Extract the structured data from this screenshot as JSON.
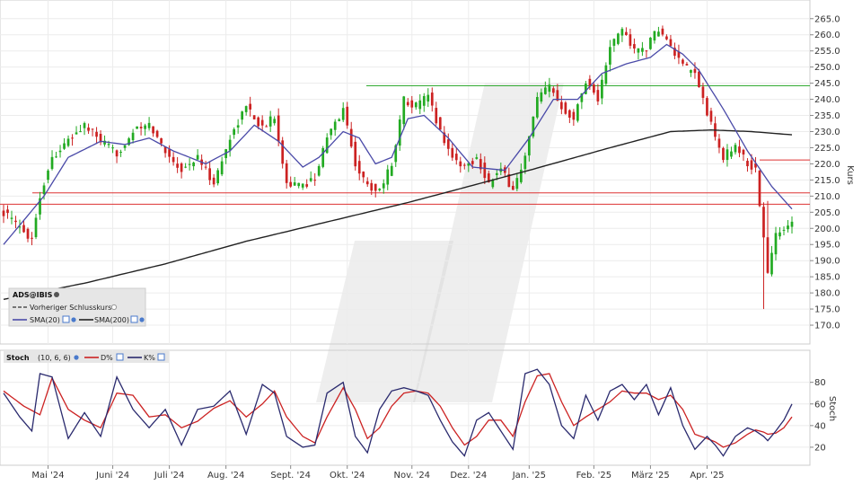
{
  "chart_data": [
    {
      "type": "candlestick",
      "ylabel": "Kurs",
      "ylim": [
        165,
        268
      ],
      "y_ticks": [
        170,
        175,
        180,
        185,
        190,
        195,
        200,
        205,
        210,
        215,
        220,
        225,
        230,
        235,
        240,
        245,
        250,
        255,
        260,
        265
      ],
      "x_labels": [
        "Mai '24",
        "Juni '24",
        "Juli '24",
        "Aug. '24",
        "Sept. '24",
        "Okt. '24",
        "Nov. '24",
        "Dez. '24",
        "Jan. '25",
        "Feb. '25",
        "März '25",
        "Apr. '25"
      ],
      "grid": true,
      "colors": {
        "up": "#22aa22",
        "down": "#cc2222",
        "sma20": "#4a4aa8",
        "sma200": "#222222",
        "support": "#dd3333",
        "resistance": "#33aa33"
      },
      "anchors": [
        [
          0,
          205
        ],
        [
          4,
          200
        ],
        [
          7,
          197
        ],
        [
          9,
          210
        ],
        [
          12,
          222
        ],
        [
          16,
          227
        ],
        [
          20,
          232
        ],
        [
          24,
          227
        ],
        [
          28,
          223
        ],
        [
          32,
          230
        ],
        [
          36,
          232
        ],
        [
          40,
          224
        ],
        [
          44,
          218
        ],
        [
          48,
          222
        ],
        [
          52,
          214
        ],
        [
          56,
          228
        ],
        [
          60,
          238
        ],
        [
          64,
          231
        ],
        [
          67,
          235
        ],
        [
          70,
          214
        ],
        [
          74,
          213
        ],
        [
          77,
          216
        ],
        [
          80,
          228
        ],
        [
          84,
          237
        ],
        [
          87,
          220
        ],
        [
          90,
          213
        ],
        [
          93,
          212
        ],
        [
          96,
          220
        ],
        [
          99,
          240
        ],
        [
          102,
          238
        ],
        [
          105,
          241
        ],
        [
          108,
          230
        ],
        [
          111,
          222
        ],
        [
          114,
          219
        ],
        [
          117,
          222
        ],
        [
          120,
          214
        ],
        [
          123,
          218
        ],
        [
          126,
          212
        ],
        [
          129,
          222
        ],
        [
          132,
          240
        ],
        [
          135,
          244
        ],
        [
          138,
          238
        ],
        [
          141,
          234
        ],
        [
          144,
          246
        ],
        [
          147,
          240
        ],
        [
          150,
          256
        ],
        [
          153,
          262
        ],
        [
          156,
          255
        ],
        [
          159,
          256
        ],
        [
          162,
          262
        ],
        [
          165,
          256
        ],
        [
          168,
          250
        ],
        [
          171,
          248
        ],
        [
          174,
          236
        ],
        [
          176,
          228
        ],
        [
          178,
          222
        ],
        [
          181,
          226
        ],
        [
          184,
          220
        ],
        [
          186,
          218
        ],
        [
          188,
          197
        ],
        [
          189,
          186
        ],
        [
          191,
          198
        ],
        [
          193,
          200
        ],
        [
          195,
          203
        ]
      ],
      "sma20_anchors": [
        [
          0,
          195
        ],
        [
          10,
          210
        ],
        [
          16,
          222
        ],
        [
          24,
          227
        ],
        [
          30,
          226
        ],
        [
          36,
          228
        ],
        [
          42,
          224
        ],
        [
          50,
          220
        ],
        [
          56,
          224
        ],
        [
          62,
          232
        ],
        [
          68,
          227
        ],
        [
          74,
          219
        ],
        [
          78,
          222
        ],
        [
          84,
          230
        ],
        [
          88,
          228
        ],
        [
          92,
          220
        ],
        [
          96,
          222
        ],
        [
          100,
          234
        ],
        [
          104,
          235
        ],
        [
          110,
          228
        ],
        [
          116,
          219
        ],
        [
          124,
          218
        ],
        [
          130,
          228
        ],
        [
          136,
          240
        ],
        [
          142,
          240
        ],
        [
          148,
          248
        ],
        [
          154,
          251
        ],
        [
          160,
          253
        ],
        [
          164,
          257
        ],
        [
          168,
          254
        ],
        [
          172,
          249
        ],
        [
          178,
          237
        ],
        [
          184,
          224
        ],
        [
          190,
          213
        ],
        [
          195,
          206
        ]
      ],
      "sma200_anchors": [
        [
          0,
          178
        ],
        [
          20,
          183
        ],
        [
          40,
          189
        ],
        [
          60,
          196
        ],
        [
          80,
          202
        ],
        [
          100,
          208
        ],
        [
          115,
          213
        ],
        [
          130,
          218
        ],
        [
          150,
          225
        ],
        [
          165,
          230
        ],
        [
          175,
          230.5
        ],
        [
          185,
          230
        ],
        [
          195,
          229
        ]
      ],
      "levels_red": [
        221.2,
        211,
        207.5
      ],
      "level_green": 244.2,
      "legend": {
        "symbol": "ADS@IBIS",
        "previous_close": "Vorheriger Schlusskurs",
        "sma20": "SMA(20)",
        "sma200": "SMA(200)"
      }
    },
    {
      "type": "line",
      "title": "Stoch",
      "params": "(10, 6, 6)",
      "ylabel": "Stoch",
      "ylim": [
        5,
        98
      ],
      "y_ticks": [
        20,
        40,
        60,
        80
      ],
      "series": [
        {
          "name": "D%",
          "color": "#cc2222"
        },
        {
          "name": "K%",
          "color": "#2a2a6e"
        }
      ],
      "k_anchors": [
        [
          0,
          70
        ],
        [
          4,
          48
        ],
        [
          7,
          35
        ],
        [
          9,
          88
        ],
        [
          12,
          85
        ],
        [
          16,
          28
        ],
        [
          20,
          52
        ],
        [
          24,
          30
        ],
        [
          28,
          85
        ],
        [
          32,
          55
        ],
        [
          36,
          38
        ],
        [
          40,
          55
        ],
        [
          44,
          22
        ],
        [
          48,
          55
        ],
        [
          52,
          58
        ],
        [
          56,
          72
        ],
        [
          60,
          32
        ],
        [
          64,
          78
        ],
        [
          67,
          70
        ],
        [
          70,
          30
        ],
        [
          74,
          20
        ],
        [
          77,
          22
        ],
        [
          80,
          70
        ],
        [
          84,
          80
        ],
        [
          87,
          30
        ],
        [
          90,
          15
        ],
        [
          93,
          55
        ],
        [
          96,
          72
        ],
        [
          99,
          75
        ],
        [
          102,
          72
        ],
        [
          105,
          68
        ],
        [
          108,
          45
        ],
        [
          111,
          25
        ],
        [
          114,
          12
        ],
        [
          117,
          45
        ],
        [
          120,
          52
        ],
        [
          123,
          35
        ],
        [
          126,
          18
        ],
        [
          129,
          88
        ],
        [
          132,
          92
        ],
        [
          135,
          78
        ],
        [
          138,
          40
        ],
        [
          141,
          28
        ],
        [
          144,
          68
        ],
        [
          147,
          45
        ],
        [
          150,
          72
        ],
        [
          153,
          78
        ],
        [
          156,
          64
        ],
        [
          159,
          78
        ],
        [
          162,
          50
        ],
        [
          165,
          75
        ],
        [
          168,
          40
        ],
        [
          171,
          18
        ],
        [
          174,
          30
        ],
        [
          176,
          22
        ],
        [
          178,
          12
        ],
        [
          181,
          30
        ],
        [
          184,
          38
        ],
        [
          186,
          35
        ],
        [
          188,
          30
        ],
        [
          189,
          26
        ],
        [
          191,
          35
        ],
        [
          193,
          45
        ],
        [
          195,
          60
        ]
      ],
      "d_anchors": [
        [
          0,
          72
        ],
        [
          5,
          58
        ],
        [
          9,
          50
        ],
        [
          12,
          84
        ],
        [
          16,
          55
        ],
        [
          20,
          45
        ],
        [
          24,
          38
        ],
        [
          28,
          70
        ],
        [
          32,
          68
        ],
        [
          36,
          48
        ],
        [
          40,
          50
        ],
        [
          44,
          38
        ],
        [
          48,
          44
        ],
        [
          52,
          56
        ],
        [
          56,
          63
        ],
        [
          60,
          48
        ],
        [
          64,
          60
        ],
        [
          67,
          72
        ],
        [
          70,
          48
        ],
        [
          74,
          30
        ],
        [
          77,
          24
        ],
        [
          80,
          48
        ],
        [
          84,
          75
        ],
        [
          87,
          55
        ],
        [
          90,
          28
        ],
        [
          93,
          38
        ],
        [
          96,
          58
        ],
        [
          99,
          70
        ],
        [
          102,
          72
        ],
        [
          105,
          70
        ],
        [
          108,
          58
        ],
        [
          111,
          38
        ],
        [
          114,
          22
        ],
        [
          117,
          30
        ],
        [
          120,
          45
        ],
        [
          123,
          45
        ],
        [
          126,
          30
        ],
        [
          129,
          62
        ],
        [
          132,
          86
        ],
        [
          135,
          88
        ],
        [
          138,
          62
        ],
        [
          141,
          40
        ],
        [
          144,
          48
        ],
        [
          147,
          55
        ],
        [
          150,
          62
        ],
        [
          153,
          72
        ],
        [
          156,
          70
        ],
        [
          159,
          70
        ],
        [
          162,
          64
        ],
        [
          165,
          68
        ],
        [
          168,
          55
        ],
        [
          171,
          32
        ],
        [
          174,
          28
        ],
        [
          176,
          25
        ],
        [
          178,
          20
        ],
        [
          181,
          24
        ],
        [
          184,
          32
        ],
        [
          186,
          36
        ],
        [
          188,
          34
        ],
        [
          189,
          32
        ],
        [
          191,
          33
        ],
        [
          193,
          38
        ],
        [
          195,
          48
        ]
      ]
    }
  ]
}
